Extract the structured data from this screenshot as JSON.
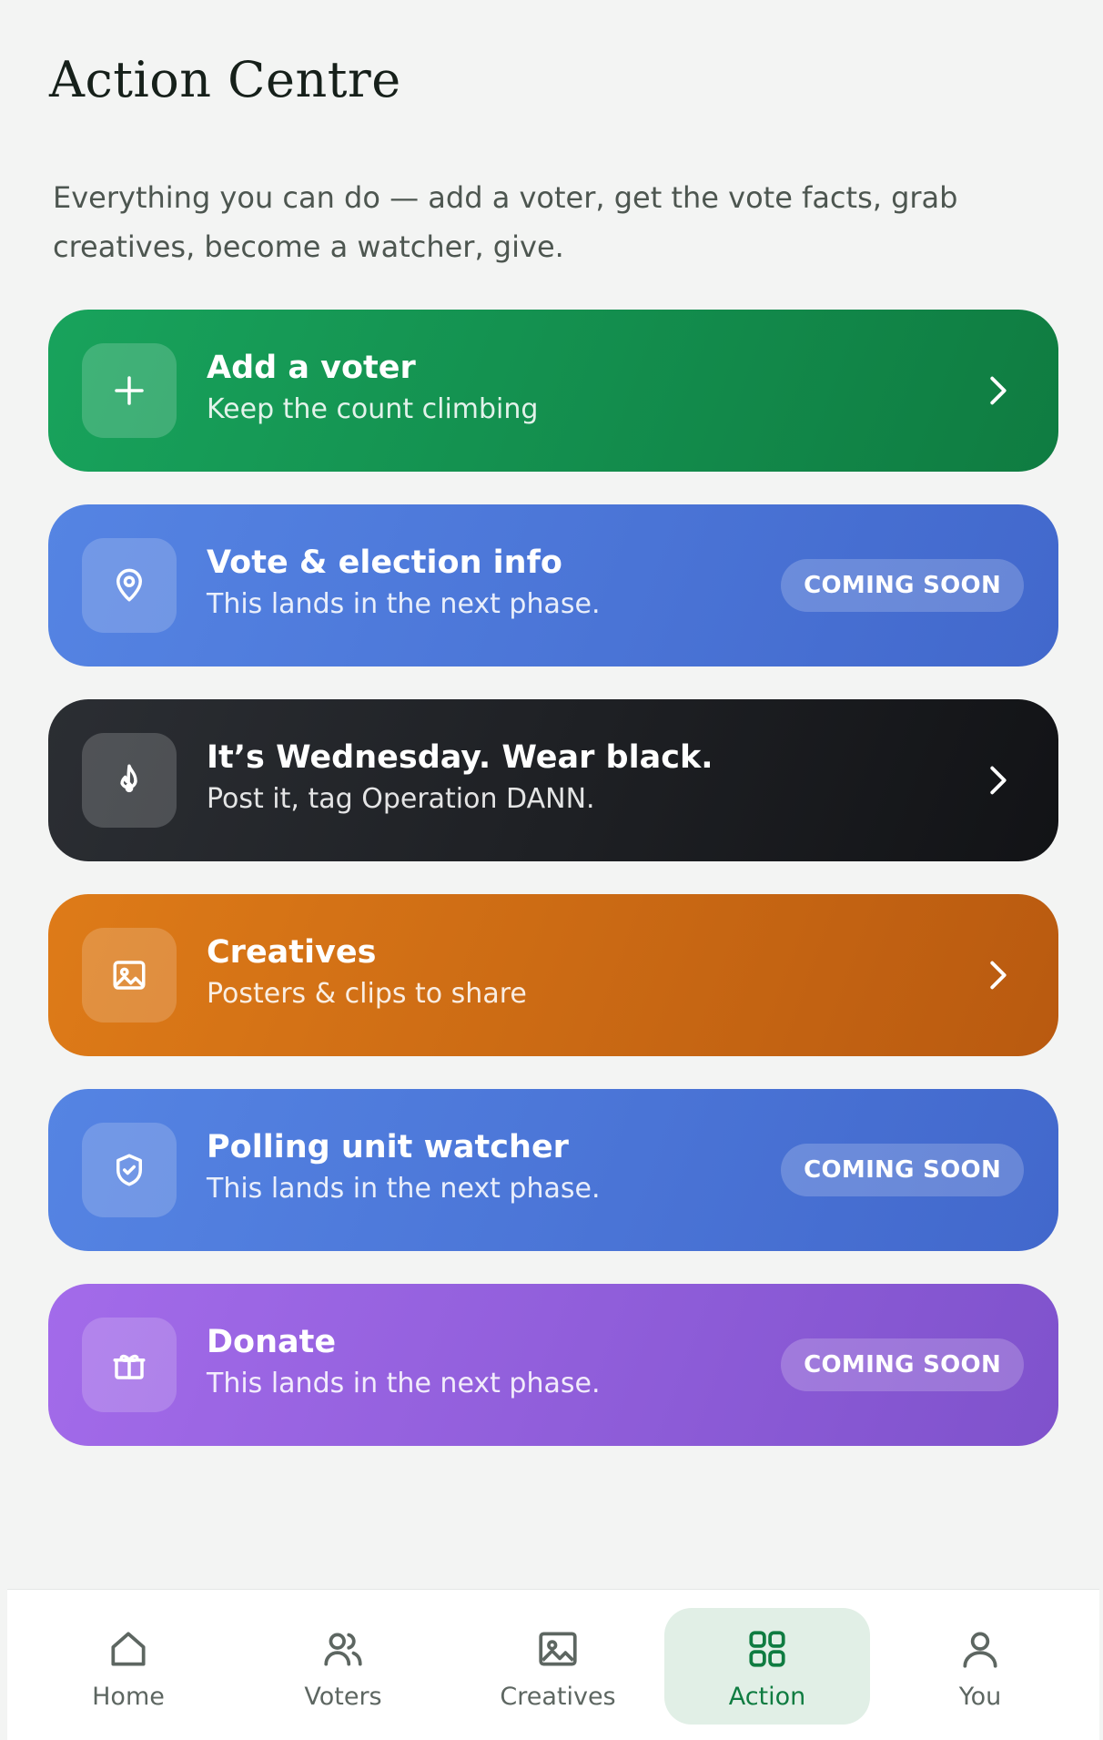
{
  "header": {
    "title": "Action Centre",
    "intro": "Everything you can do — add a voter, get the vote facts, grab creatives, become a watcher, give."
  },
  "cards": [
    {
      "title": "Add a voter",
      "subtitle": "Keep the count climbing",
      "icon": "plus-icon",
      "badge": null,
      "color": "#16a05a"
    },
    {
      "title": "Vote & election info",
      "subtitle": "This lands in the next phase.",
      "icon": "location-pin-icon",
      "badge": "COMING SOON",
      "color": "#4f7ddd"
    },
    {
      "title": "It’s Wednesday. Wear black.",
      "subtitle": "Post it, tag Operation DANN.",
      "icon": "flame-icon",
      "badge": null,
      "color": "#1e2024"
    },
    {
      "title": "Creatives",
      "subtitle": "Posters & clips to share",
      "icon": "image-icon",
      "badge": null,
      "color": "#d66f16"
    },
    {
      "title": "Polling unit watcher",
      "subtitle": "This lands in the next phase.",
      "icon": "shield-check-icon",
      "badge": "COMING SOON",
      "color": "#4f7ddd"
    },
    {
      "title": "Donate",
      "subtitle": "This lands in the next phase.",
      "icon": "gift-icon",
      "badge": "COMING SOON",
      "color": "#9662e0"
    }
  ],
  "nav": {
    "items": [
      {
        "label": "Home",
        "icon": "home-icon"
      },
      {
        "label": "Voters",
        "icon": "users-icon"
      },
      {
        "label": "Creatives",
        "icon": "image-icon"
      },
      {
        "label": "Action",
        "icon": "grid-icon",
        "active": true
      },
      {
        "label": "You",
        "icon": "user-icon"
      }
    ],
    "active_color": "#0f7c41"
  }
}
